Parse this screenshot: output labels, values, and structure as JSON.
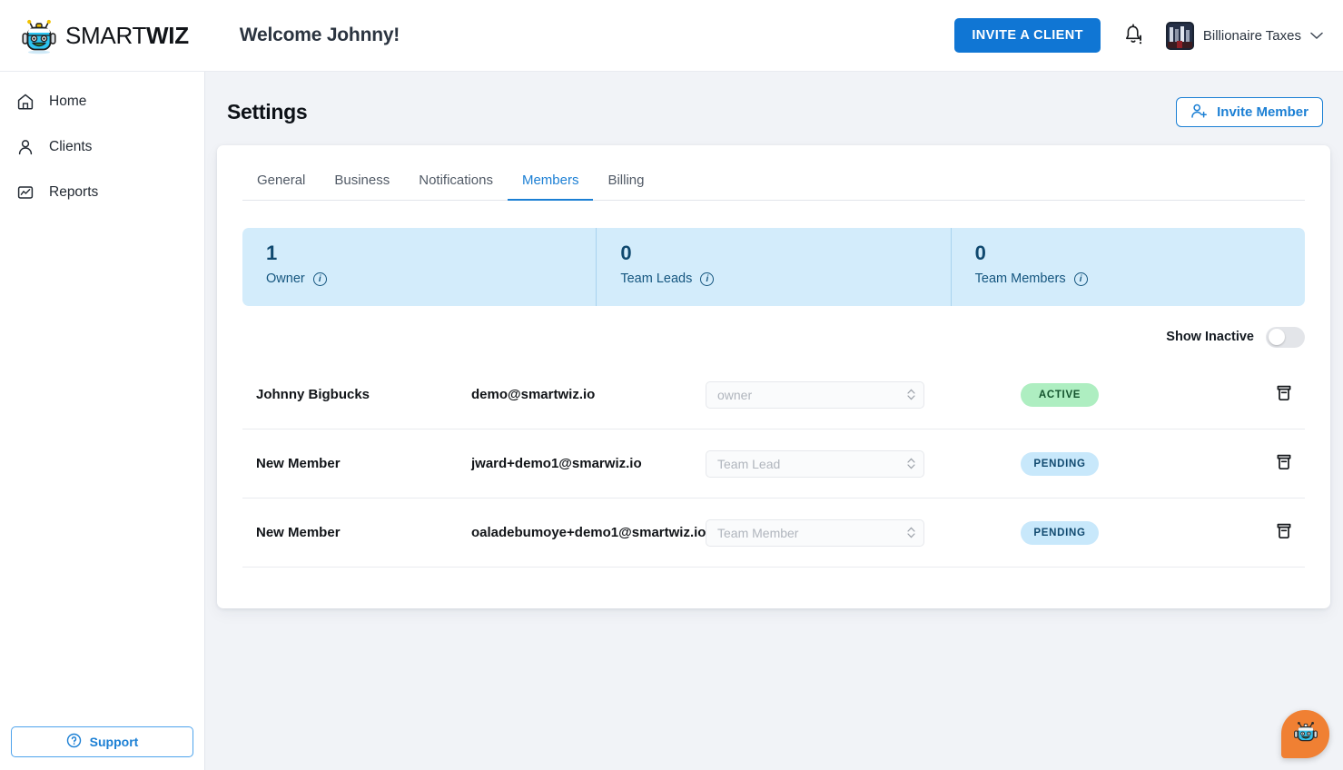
{
  "brand": {
    "logo_text_light": "SMART",
    "logo_text_bold": "WIZ",
    "logo_icon": "robot-icon",
    "accent_blue": "#1076d4",
    "accent_orange": "#f08033"
  },
  "topbar": {
    "welcome": "Welcome Johnny!",
    "invite_client_label": "INVITE A CLIENT",
    "notification_icon": "bell-alert-icon",
    "profile_name": "Billionaire Taxes",
    "profile_chevron": "chevron-down-icon"
  },
  "sidebar": {
    "items": [
      {
        "label": "Home",
        "icon": "home-icon"
      },
      {
        "label": "Clients",
        "icon": "person-icon"
      },
      {
        "label": "Reports",
        "icon": "chart-box-icon"
      }
    ],
    "support_label": "Support",
    "support_icon": "question-circle-icon"
  },
  "page": {
    "title": "Settings",
    "invite_member_label": "Invite Member",
    "invite_member_icon": "person-add-icon"
  },
  "tabs": [
    {
      "label": "General",
      "active": false
    },
    {
      "label": "Business",
      "active": false
    },
    {
      "label": "Notifications",
      "active": false
    },
    {
      "label": "Members",
      "active": true
    },
    {
      "label": "Billing",
      "active": false
    }
  ],
  "stats": [
    {
      "value": "1",
      "label": "Owner",
      "info_icon": "info-icon"
    },
    {
      "value": "0",
      "label": "Team Leads",
      "info_icon": "info-icon"
    },
    {
      "value": "0",
      "label": "Team Members",
      "info_icon": "info-icon"
    }
  ],
  "toolbar": {
    "show_inactive_label": "Show Inactive",
    "show_inactive_on": false
  },
  "members": [
    {
      "name": "Johnny Bigbucks",
      "email": "demo@smartwiz.io",
      "role_placeholder": "owner",
      "status": "ACTIVE",
      "status_kind": "active",
      "delete_icon": "trash-icon"
    },
    {
      "name": "New Member",
      "email": "jward+demo1@smarwiz.io",
      "role_placeholder": "Team Lead",
      "status": "PENDING",
      "status_kind": "pending",
      "delete_icon": "trash-icon"
    },
    {
      "name": "New Member",
      "email": "oaladebumoye+demo1@smartwiz.io",
      "role_placeholder": "Team Member",
      "status": "PENDING",
      "status_kind": "pending",
      "delete_icon": "trash-icon"
    }
  ],
  "chat": {
    "icon": "robot-chat-icon"
  }
}
